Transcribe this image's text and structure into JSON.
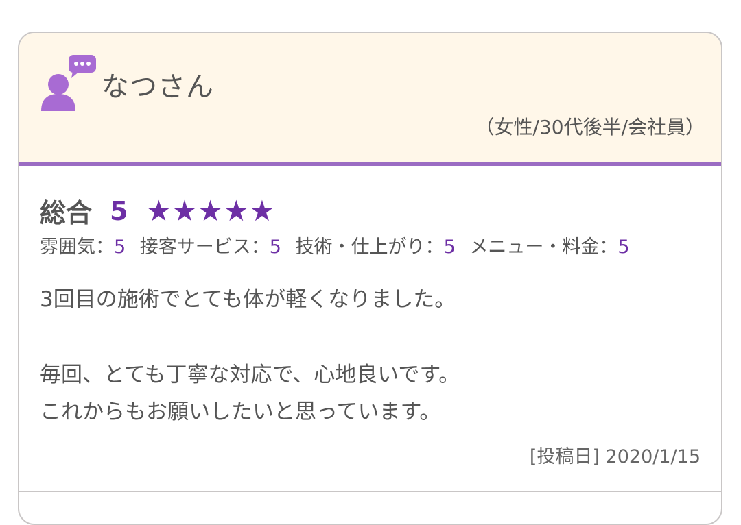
{
  "review": {
    "user_name": "なつさん",
    "user_profile": "（女性/30代後半/会社員）",
    "overall_label": "総合",
    "overall_score": "5",
    "star_count": 5,
    "star_glyph": "★",
    "sub_ratings": [
      {
        "label": "雰囲気：",
        "value": "5"
      },
      {
        "label": "接客サービス：",
        "value": "5"
      },
      {
        "label": "技術・仕上がり：",
        "value": "5"
      },
      {
        "label": "メニュー・料金：",
        "value": "5"
      }
    ],
    "comment_lines": [
      "3回目の施術でとても体が軽くなりました。",
      "",
      "毎回、とても丁寧な対応で、心地良いです。",
      "これからもお願いしたいと思っています。"
    ],
    "post_date": "[投稿日] 2020/1/15"
  },
  "colors": {
    "accent_purple": "#6d2fa5",
    "header_bg": "#fff7e9",
    "header_border": "#9b6cc3",
    "icon_purple": "#a86bd3",
    "text_gray": "#555555"
  },
  "icons": {
    "avatar": "user-with-speech-bubble-icon",
    "star": "star-icon"
  }
}
